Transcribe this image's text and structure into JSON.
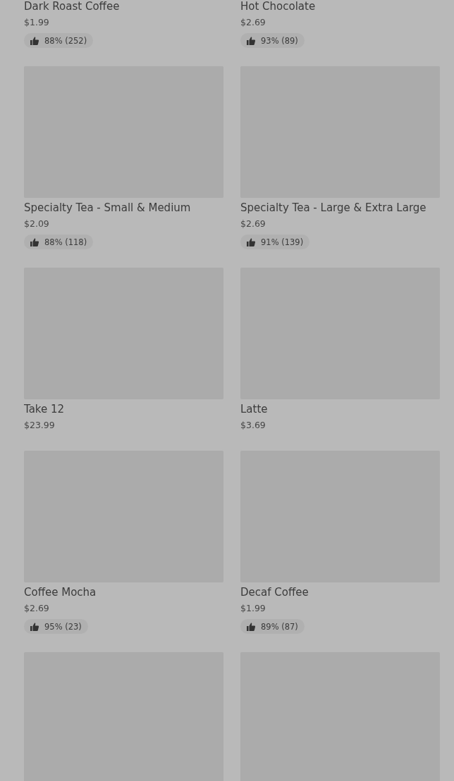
{
  "products": [
    {
      "name": "Dark Roast Coffee",
      "price": "$1.99",
      "rating": "88% (252)"
    },
    {
      "name": "Hot Chocolate",
      "price": "$2.69",
      "rating": "93% (89)"
    },
    {
      "image": {
        "kind": "picture"
      },
      "name": "Specialty Tea - Small & Medium",
      "price": "$2.09",
      "rating": "88% (118)"
    },
    {
      "image": {
        "kind": "picture"
      },
      "name": "Specialty Tea - Large & Extra Large",
      "price": "$2.69",
      "rating": "91% (139)"
    },
    {
      "image": {
        "kind": "picture"
      },
      "name": "Take 12",
      "price": "$23.99"
    },
    {
      "image": {
        "kind": "picture"
      },
      "name": "Latte",
      "price": "$3.69"
    },
    {
      "image": {
        "kind": "picture"
      },
      "name": "Coffee Mocha",
      "price": "$2.69",
      "rating": "95% (23)"
    },
    {
      "image": {
        "kind": "picture"
      },
      "name": "Decaf Coffee",
      "price": "$1.99",
      "rating": "89% (87)"
    },
    {
      "image": {
        "kind": "picture"
      }
    },
    {
      "image": {
        "kind": "picture"
      }
    }
  ]
}
